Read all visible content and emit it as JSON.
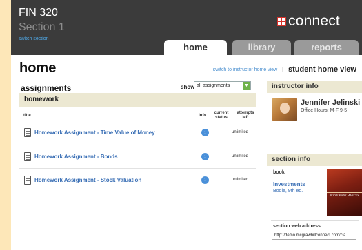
{
  "header": {
    "course_code": "FIN 320",
    "section_label": "Section 1",
    "switch_section": "switch section",
    "brand": "connect",
    "tabs": [
      "home",
      "library",
      "reports"
    ]
  },
  "page": {
    "title": "home",
    "switch_view_link": "switch to instructor home view",
    "separator": "|",
    "current_view": "student home view"
  },
  "assignments": {
    "heading": "assignments",
    "show_label": "show:",
    "show_value": "all assignments",
    "group": "homework",
    "columns": {
      "title": "title",
      "info": "info",
      "status": "current status",
      "attempts": "attempts left"
    },
    "rows": [
      {
        "title": "Homework Assignment - Time Value of Money",
        "attempts": "unlimited"
      },
      {
        "title": "Homework Assignment - Bonds",
        "attempts": "unlimited"
      },
      {
        "title": "Homework Assignment - Stock Valuation",
        "attempts": "unlimited"
      }
    ]
  },
  "instructor": {
    "heading": "instructor info",
    "name": "Jennifer Jelinski",
    "office_hours": "Office Hours: M-F 9-5"
  },
  "section_info": {
    "heading": "section info",
    "book_label": "book",
    "book_title": "Investments",
    "book_edition": "Bodie, 9th ed.",
    "cover_text": "BODIE KANE MARCUS",
    "web_label": "section web address:",
    "web_address": "http://demo.mcgrawhillconnect.com/cla"
  },
  "colors": {
    "page_background": "#fde7b8",
    "header_background": "#3b3b3b",
    "link": "#3a6fb5",
    "section_bar": "#ece8d2",
    "brand_mark": "#d6322a",
    "select_button": "#6fb24a",
    "info_icon": "#4a90d9"
  },
  "icons": {
    "brand_mark": "connect-logo-icon",
    "assignment": "document-icon",
    "info": "info-icon",
    "select_arrow": "chevron-down-icon"
  }
}
